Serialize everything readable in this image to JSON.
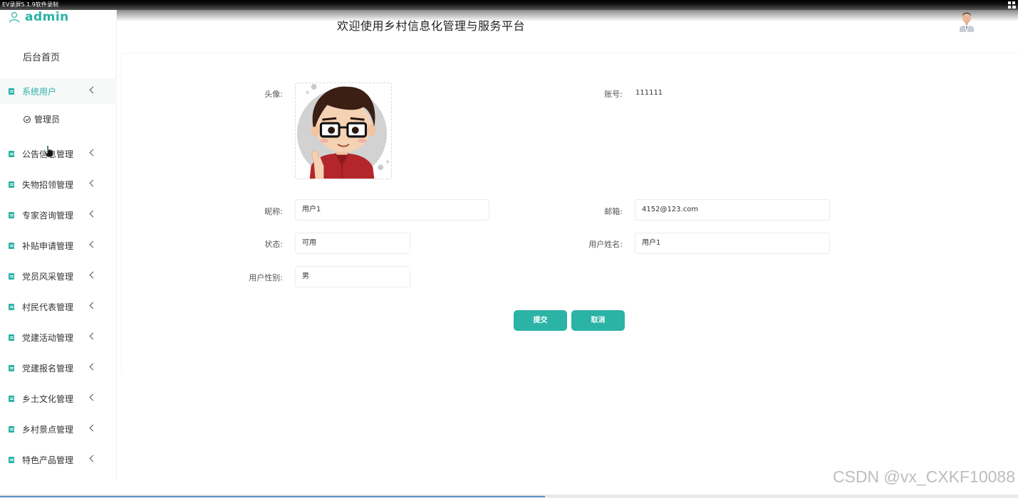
{
  "recorder": {
    "title": "EV录屏5.1.9软件录制"
  },
  "brand": {
    "name": "admin"
  },
  "header": {
    "title": "欢迎使用乡村信息化管理与服务平台"
  },
  "sidebar": {
    "home": "后台首页",
    "items": [
      {
        "label": "系统用户",
        "active": true
      },
      {
        "label": "公告信息管理"
      },
      {
        "label": "失物招领管理"
      },
      {
        "label": "专家咨询管理"
      },
      {
        "label": "补贴申请管理"
      },
      {
        "label": "党员风采管理"
      },
      {
        "label": "村民代表管理"
      },
      {
        "label": "党建活动管理"
      },
      {
        "label": "党建报名管理"
      },
      {
        "label": "乡土文化管理"
      },
      {
        "label": "乡村景点管理"
      },
      {
        "label": "特色产品管理"
      }
    ],
    "sub_item": "管理员"
  },
  "form": {
    "avatar_label": "头像:",
    "account_label": "账号:",
    "account_value": "111111",
    "nickname_label": "昵称:",
    "nickname_value": "用户1",
    "email_label": "邮箱:",
    "email_value": "4152@123.com",
    "status_label": "状态:",
    "status_value": "可用",
    "username_label": "用户姓名:",
    "username_value": "用户1",
    "gender_label": "用户性别:",
    "gender_value": "男"
  },
  "buttons": {
    "submit": "提交",
    "cancel": "取消"
  },
  "watermark": "CSDN @vx_CXKF10088",
  "colors": {
    "accent": "#2bb3a6"
  }
}
